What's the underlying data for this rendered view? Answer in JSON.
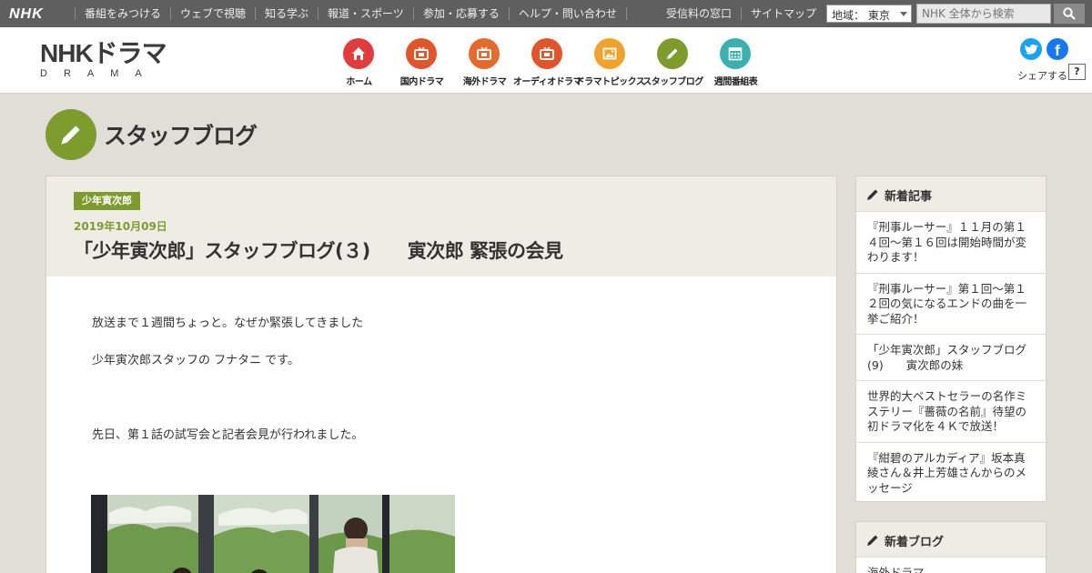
{
  "global_bar": {
    "logo": "NHK",
    "links": [
      "番組をみつける",
      "ウェブで視聴",
      "知る学ぶ",
      "報道・スポーツ",
      "参加・応募する",
      "ヘルプ・問い合わせ"
    ],
    "right_links": [
      "受信料の窓口",
      "サイトマップ"
    ],
    "region_label": "地域：",
    "region_value": "東京",
    "search_placeholder": "NHK 全体から検索"
  },
  "header": {
    "logo_main": "NHKドラマ",
    "logo_sub": "DRAMA",
    "nav": [
      {
        "label": "ホーム",
        "color": "#e03c3c",
        "icon": "house-icon"
      },
      {
        "label": "国内ドラマ",
        "color": "#e0562a",
        "icon": "tv-icon"
      },
      {
        "label": "海外ドラマ",
        "color": "#e66a2b",
        "icon": "tv-icon"
      },
      {
        "label": "オーディオドラマ",
        "color": "#e2552c",
        "icon": "tv-icon"
      },
      {
        "label": "ドラマトピックス",
        "color": "#f0a22b",
        "icon": "picture-icon"
      },
      {
        "label": "スタッフブログ",
        "color": "#7e9c2d",
        "icon": "pencil-icon"
      },
      {
        "label": "週間番組表",
        "color": "#3ab0b0",
        "icon": "calendar-icon"
      }
    ],
    "share_label": "シェアする",
    "help_label": "?"
  },
  "page": {
    "title": "スタッフブログ"
  },
  "article": {
    "category": "少年寅次郎",
    "date": "2019年10月09日",
    "title": "「少年寅次郎」スタッフブログ(３)　　寅次郎 緊張の会見",
    "body": [
      "放送まで１週間ちょっと。なぜか緊張してきました",
      "少年寅次郎スタッフの フナタニ です。",
      "先日、第１話の試写会と記者会見が行われました。"
    ]
  },
  "sidebar": {
    "new_articles": {
      "heading": "新着記事",
      "items": [
        "『刑事ルーサー』１１月の第１４回～第１６回は開始時間が変わります！",
        "『刑事ルーサー』第１回～第１２回の気になるエンドの曲を一挙ご紹介！",
        "「少年寅次郎」スタッフブログ(9)　　寅次郎の妹",
        "世界的大ベストセラーの名作ミステリー『薔薇の名前』待望の初ドラマ化を４Ｋで放送！",
        "『紺碧のアルカディア』坂本真綾さん＆井上芳雄さんからのメッセージ"
      ]
    },
    "new_blogs": {
      "heading": "新着ブログ",
      "items": [
        "海外ドラマ"
      ]
    }
  }
}
